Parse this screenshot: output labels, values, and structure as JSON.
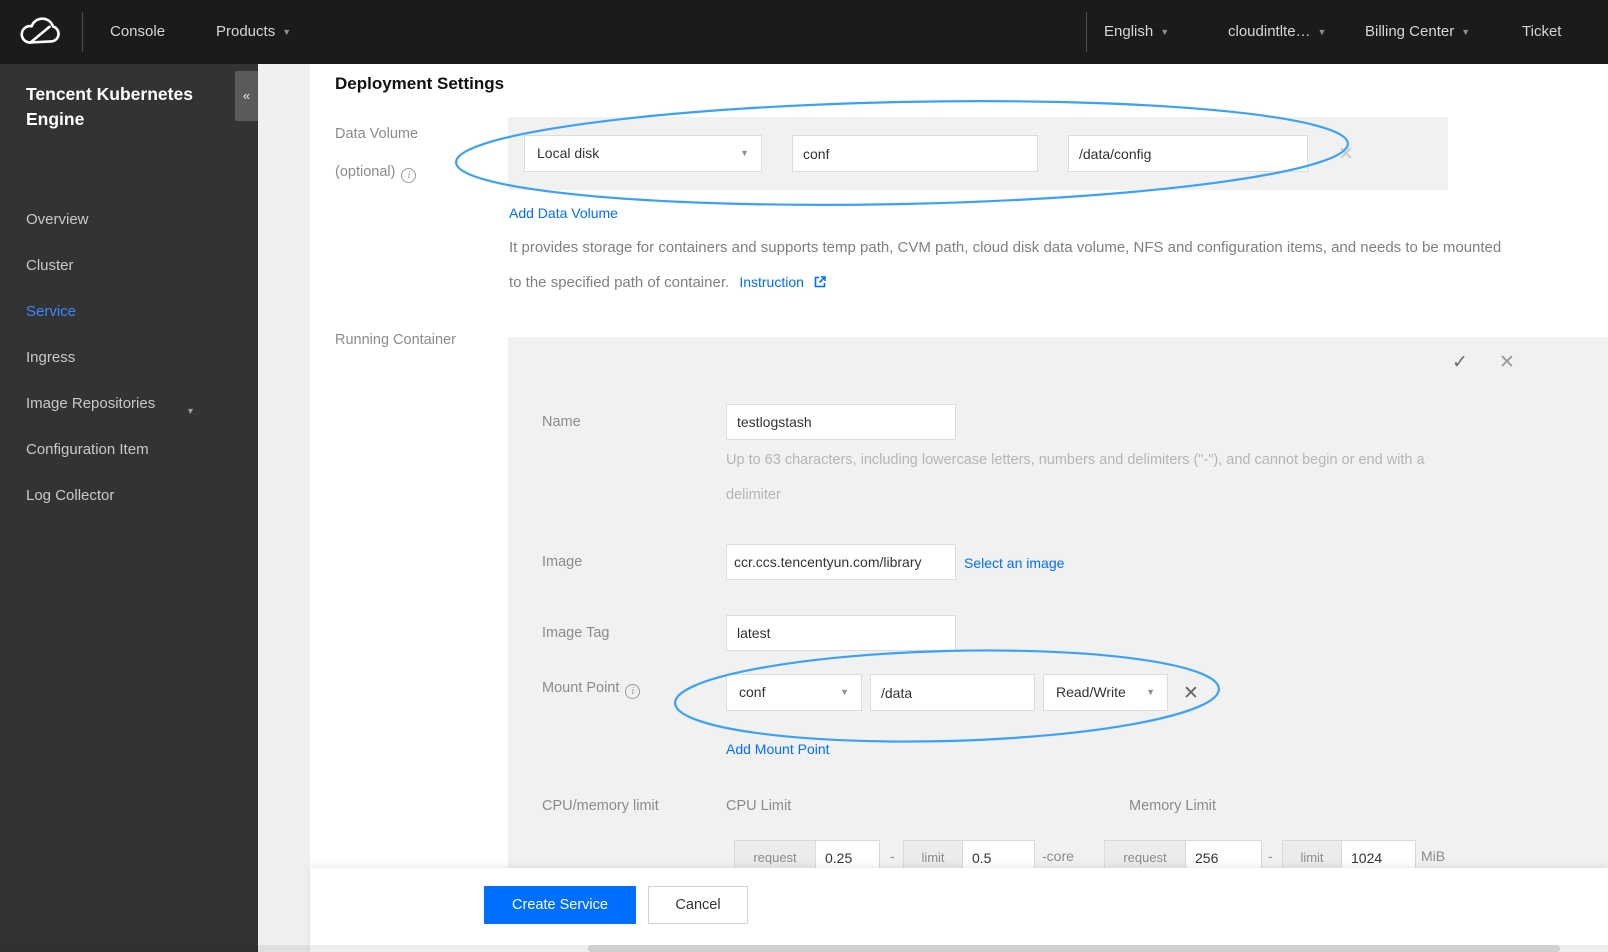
{
  "nav": {
    "console": "Console",
    "products": "Products",
    "language": "English",
    "account": "cloudintlte…",
    "billing": "Billing Center",
    "ticket": "Ticket"
  },
  "sidebar": {
    "title": "Tencent Kubernetes Engine",
    "items": [
      {
        "label": "Overview"
      },
      {
        "label": "Cluster"
      },
      {
        "label": "Service"
      },
      {
        "label": "Ingress"
      },
      {
        "label": "Image Repositories"
      },
      {
        "label": "Configuration Item"
      },
      {
        "label": "Log Collector"
      }
    ]
  },
  "main": {
    "heading": "Deployment Settings",
    "data_volume": {
      "label_line1": "Data Volume",
      "label_line2": "(optional)",
      "type_value": "Local disk",
      "name_value": "conf",
      "path_value": "/data/config",
      "add_link": "Add Data Volume",
      "desc_line1": "It provides storage for containers and supports temp path, CVM path, cloud disk data volume, NFS and configuration items, and needs to be mounted",
      "desc_line2": "to the specified path of container.",
      "instruction_link": "Instruction"
    },
    "running_container": {
      "label": "Running Container",
      "name_label": "Name",
      "name_value": "testlogstash",
      "name_help_line1": "Up to 63 characters, including lowercase letters, numbers and delimiters (\"-\"), and cannot begin or end with a",
      "name_help_line2": "delimiter",
      "image_label": "Image",
      "image_value": "ccr.ccs.tencentyun.com/library",
      "select_image_link": "Select an image",
      "image_tag_label": "Image Tag",
      "image_tag_value": "latest",
      "mount_point_label": "Mount Point",
      "mount_volume_value": "conf",
      "mount_path_value": "/data",
      "mount_mode_value": "Read/Write",
      "add_mount_link": "Add Mount Point",
      "cpu_mem_label": "CPU/memory limit",
      "cpu_limit_header": "CPU Limit",
      "memory_limit_header": "Memory Limit",
      "cpu_request_label": "request",
      "cpu_request_value": "0.25",
      "cpu_limit_label": "limit",
      "cpu_limit_value": "0.5",
      "cpu_unit": "-core",
      "mem_request_label": "request",
      "mem_request_value": "256",
      "mem_limit_label": "limit",
      "mem_limit_value": "1024",
      "mem_unit": "MiB",
      "range_separator": "-"
    }
  },
  "footer": {
    "create_label": "Create Service",
    "cancel_label": "Cancel"
  },
  "icons": {
    "collapse": "«",
    "caret_down": "▼",
    "check": "✓",
    "close": "✕",
    "info": "i"
  },
  "colors": {
    "link_blue": "#006eff",
    "sidebar_active_blue": "#4086ff",
    "annotation_blue": "#3aa1f8",
    "nav_bg": "#1b1b1b",
    "sidebar_bg": "#333333",
    "panel_gray": "#f1f1f1"
  }
}
